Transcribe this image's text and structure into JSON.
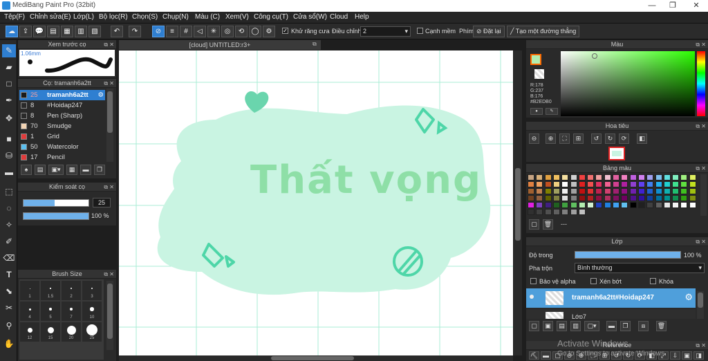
{
  "window": {
    "title": "MediBang Paint Pro (32bit)",
    "minimize": "—",
    "maximize": "❐",
    "close": "✕"
  },
  "menu": [
    "Tệp(F)",
    "Chỉnh sửa(E)",
    "Lớp(L)",
    "Bộ lọc(R)",
    "Chọn(S)",
    "Chụp(N)",
    "Màu (C)",
    "Xem(V)",
    "Công cụ(T)",
    "Cửa sổ(W)",
    "Cloud",
    "Help"
  ],
  "toolbar": {
    "antialias_label": "Khử răng cưa",
    "adjust_label": "Điều chỉnh",
    "adjust_value": "2",
    "snap_label": "Cạnh mềm",
    "key_label": "Phím",
    "reset_label": "Đặt lại",
    "line_label": "Tạo một đường thẳng"
  },
  "brush_preview": {
    "title": "Xem trước cọ",
    "size": "1.06mm"
  },
  "brush_list": {
    "title": "Cọ: tramanh6a2tt",
    "items": [
      {
        "num": "25",
        "name": "tramanh6a2tt",
        "color": "#1a1a1a"
      },
      {
        "num": "8",
        "name": "#Hoidap247",
        "color": "#2a2a2a"
      },
      {
        "num": "8",
        "name": "Pen (Sharp)",
        "color": "#2a2a2a"
      },
      {
        "num": "70",
        "name": "Smudge",
        "color": "#f1d3b3"
      },
      {
        "num": "1",
        "name": "Grid",
        "color": "#e03b3b"
      },
      {
        "num": "50",
        "name": "Watercolor",
        "color": "#5bc0f0"
      },
      {
        "num": "17",
        "name": "Pencil",
        "color": "#e03b3b"
      }
    ]
  },
  "brush_control": {
    "title": "Kiểm soát cọ",
    "size_value": "25",
    "size_fraction": 0.48,
    "opacity_value": "100 %",
    "opacity_fraction": 1.0
  },
  "brush_size": {
    "title": "Brush Size",
    "labels": [
      "1",
      "1.5",
      "2",
      "3",
      "4",
      "5",
      "7",
      "10",
      "12",
      "15",
      "20",
      "25"
    ]
  },
  "doc_tab": "[cloud] UNTITLED:r3+",
  "artwork": {
    "text": "Thất vọng",
    "mint": "#c9f4e2",
    "ink": "#8edfa7",
    "accent": "#4ed6a8"
  },
  "color_panel": {
    "title": "Màu",
    "r": "R:178",
    "g": "G:237",
    "b": "B:176",
    "hex": "#B2EDB0",
    "primary": "#B2EDB0"
  },
  "navigator": {
    "title": "Hoa tiêu"
  },
  "palette": {
    "title": "Bảng màu",
    "more": "---",
    "rows": [
      [
        "#c7a483",
        "#d8b07a",
        "#e0a040",
        "#f0c060",
        "#f5e0a0",
        "#d0d0d0",
        "#f04040",
        "#f07070",
        "#f0a0a0",
        "#f0c0d0",
        "#e060a0",
        "#f080c0",
        "#c060e0",
        "#d080f0",
        "#a0a0f0",
        "#80c0f0",
        "#60e0e0",
        "#80f0c0",
        "#a0f080",
        "#e0f060"
      ],
      [
        "#e08040",
        "#f0a060",
        "#c05020",
        "#f0d080",
        "#ffffff",
        "#c0c0c0",
        "#e02020",
        "#f05050",
        "#e03060",
        "#f06090",
        "#d04090",
        "#b020a0",
        "#9040d0",
        "#6040f0",
        "#4080f0",
        "#20b0f0",
        "#20d0d0",
        "#40e090",
        "#60e040",
        "#c0e020"
      ],
      [
        "#a06030",
        "#c08050",
        "#808000",
        "#a0a060",
        "#f0f0f0",
        "#a0a0a0",
        "#c01010",
        "#e03030",
        "#c02050",
        "#d04070",
        "#a02070",
        "#901080",
        "#7020b0",
        "#4020d0",
        "#2060d0",
        "#1090d0",
        "#10b0b0",
        "#20c070",
        "#40c020",
        "#a0c010"
      ],
      [
        "#704020",
        "#906040",
        "#606000",
        "#808040",
        "#e0e0e0",
        "#808080",
        "#901010",
        "#b02020",
        "#901040",
        "#b03060",
        "#801060",
        "#700060",
        "#501090",
        "#3010a0",
        "#1040a0",
        "#0070a0",
        "#009090",
        "#109050",
        "#30a010",
        "#809010"
      ],
      [
        "#e020e0",
        "#8040c0",
        "#402080",
        "#206020",
        "#40a040",
        "#60c060",
        "#b2edb0",
        "#d0f0d0",
        "#2040c0",
        "#2080e0",
        "#40a0f0",
        "#60c0f0",
        "#000000",
        "#202020",
        "#404040",
        "#606060",
        "#e8e8e8",
        "#f4f4f4",
        "#ffffff",
        "#ffffff"
      ],
      [
        "#303030",
        "#404040",
        "#505050",
        "#606060",
        "#808080",
        "#a0a0a0",
        "#c0c0c0"
      ]
    ]
  },
  "layers": {
    "title": "Lớp",
    "opacity_label": "Độ trong",
    "opacity_value": "100 %",
    "opacity_fraction": 1.0,
    "blend_label": "Pha trộn",
    "blend_value": "Bình thường",
    "protect_alpha": "Bảo vệ alpha",
    "clipping": "Xén bớt",
    "lock": "Khóa",
    "items": [
      {
        "name": "tramanh6a2tt#Hoidap247",
        "selected": true
      },
      {
        "name": "Lớp7",
        "selected": false
      }
    ]
  },
  "reference": {
    "title": "Reference"
  },
  "watermark": {
    "line1": "Activate Windows",
    "line2": "Go to Settings to activate Windows."
  }
}
